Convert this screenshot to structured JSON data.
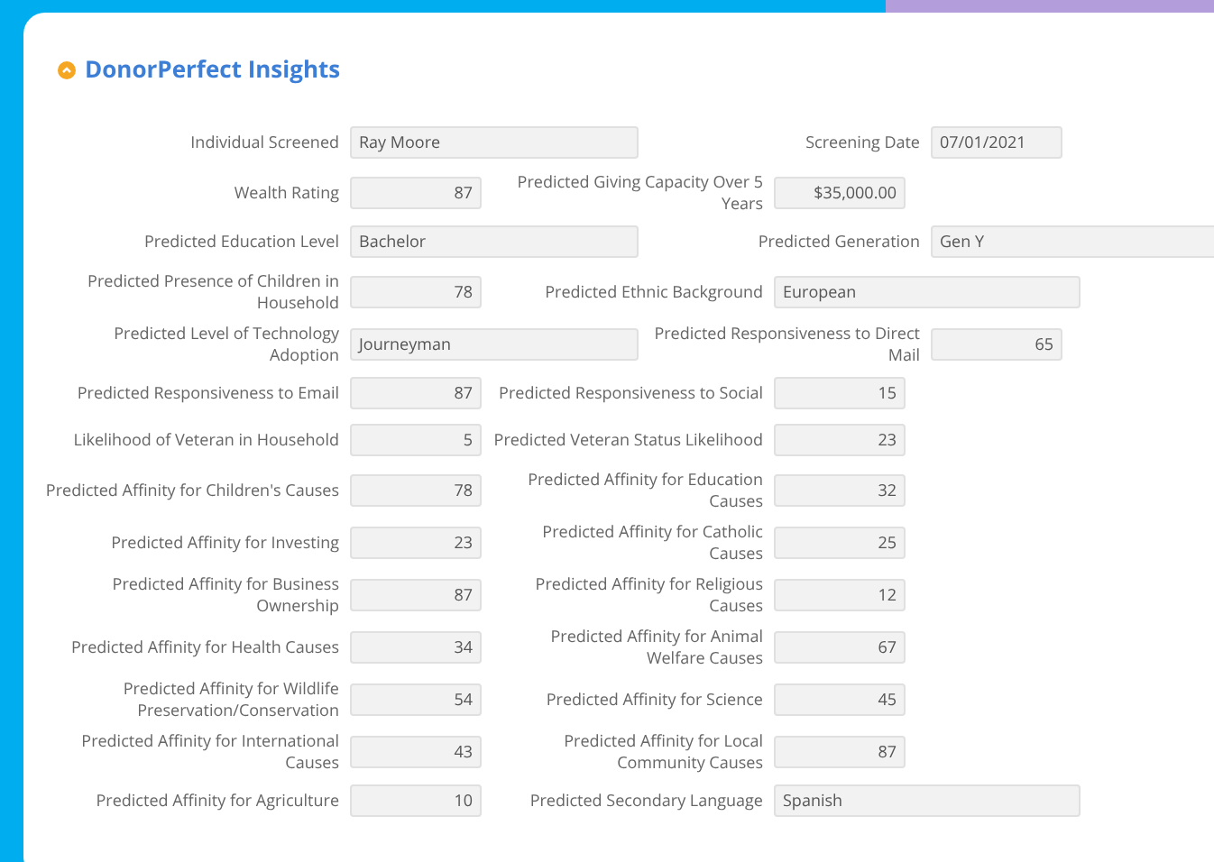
{
  "section": {
    "title": "DonorPerfect Insights",
    "expanded": true
  },
  "rows": [
    {
      "left": {
        "label": "Individual Screened",
        "value": "Ray Moore",
        "kind": "text"
      },
      "right": {
        "label": "Screening Date",
        "value": "07/01/2021",
        "kind": "date"
      }
    },
    {
      "left": {
        "label": "Wealth Rating",
        "value": "87",
        "kind": "number"
      },
      "right": {
        "label": "Predicted Giving Capacity Over 5 Years",
        "value": "$35,000.00",
        "kind": "number"
      }
    },
    {
      "left": {
        "label": "Predicted Education Level",
        "value": "Bachelor",
        "kind": "text"
      },
      "right": {
        "label": "Predicted Generation",
        "value": "Gen Y",
        "kind": "text"
      }
    },
    {
      "left": {
        "label": "Predicted Presence of Children in Household",
        "value": "78",
        "kind": "number"
      },
      "right": {
        "label": "Predicted Ethnic Background",
        "value": "European",
        "kind": "text"
      }
    },
    {
      "left": {
        "label": "Predicted Level of Technology Adoption",
        "value": "Journeyman",
        "kind": "text"
      },
      "right": {
        "label": "Predicted Responsiveness to Direct Mail",
        "value": "65",
        "kind": "number"
      }
    },
    {
      "left": {
        "label": "Predicted Responsiveness to Email",
        "value": "87",
        "kind": "number"
      },
      "right": {
        "label": "Predicted Responsiveness to Social",
        "value": "15",
        "kind": "number"
      }
    },
    {
      "left": {
        "label": "Likelihood of Veteran in Household",
        "value": "5",
        "kind": "number"
      },
      "right": {
        "label": "Predicted Veteran Status Likelihood",
        "value": "23",
        "kind": "number"
      }
    },
    {
      "left": {
        "label": "Predicted Affinity for Children's Causes",
        "value": "78",
        "kind": "number"
      },
      "right": {
        "label": "Predicted Affinity for Education Causes",
        "value": "32",
        "kind": "number"
      }
    },
    {
      "left": {
        "label": "Predicted Affinity for Investing",
        "value": "23",
        "kind": "number"
      },
      "right": {
        "label": "Predicted Affinity for Catholic Causes",
        "value": "25",
        "kind": "number"
      }
    },
    {
      "left": {
        "label": "Predicted Affinity for Business Ownership",
        "value": "87",
        "kind": "number"
      },
      "right": {
        "label": "Predicted Affinity for Religious Causes",
        "value": "12",
        "kind": "number"
      }
    },
    {
      "left": {
        "label": "Predicted Affinity for Health Causes",
        "value": "34",
        "kind": "number"
      },
      "right": {
        "label": "Predicted Affinity for Animal Welfare Causes",
        "value": "67",
        "kind": "number"
      }
    },
    {
      "left": {
        "label": "Predicted Affinity for Wildlife Preservation/Conservation",
        "value": "54",
        "kind": "number"
      },
      "right": {
        "label": "Predicted Affinity for Science",
        "value": "45",
        "kind": "number"
      }
    },
    {
      "left": {
        "label": "Predicted Affinity for International Causes",
        "value": "43",
        "kind": "number"
      },
      "right": {
        "label": "Predicted Affinity for Local Community Causes",
        "value": "87",
        "kind": "number"
      }
    },
    {
      "left": {
        "label": "Predicted Affinity for Agriculture",
        "value": "10",
        "kind": "number"
      },
      "right": {
        "label": "Predicted Secondary Language",
        "value": "Spanish",
        "kind": "text"
      }
    }
  ]
}
